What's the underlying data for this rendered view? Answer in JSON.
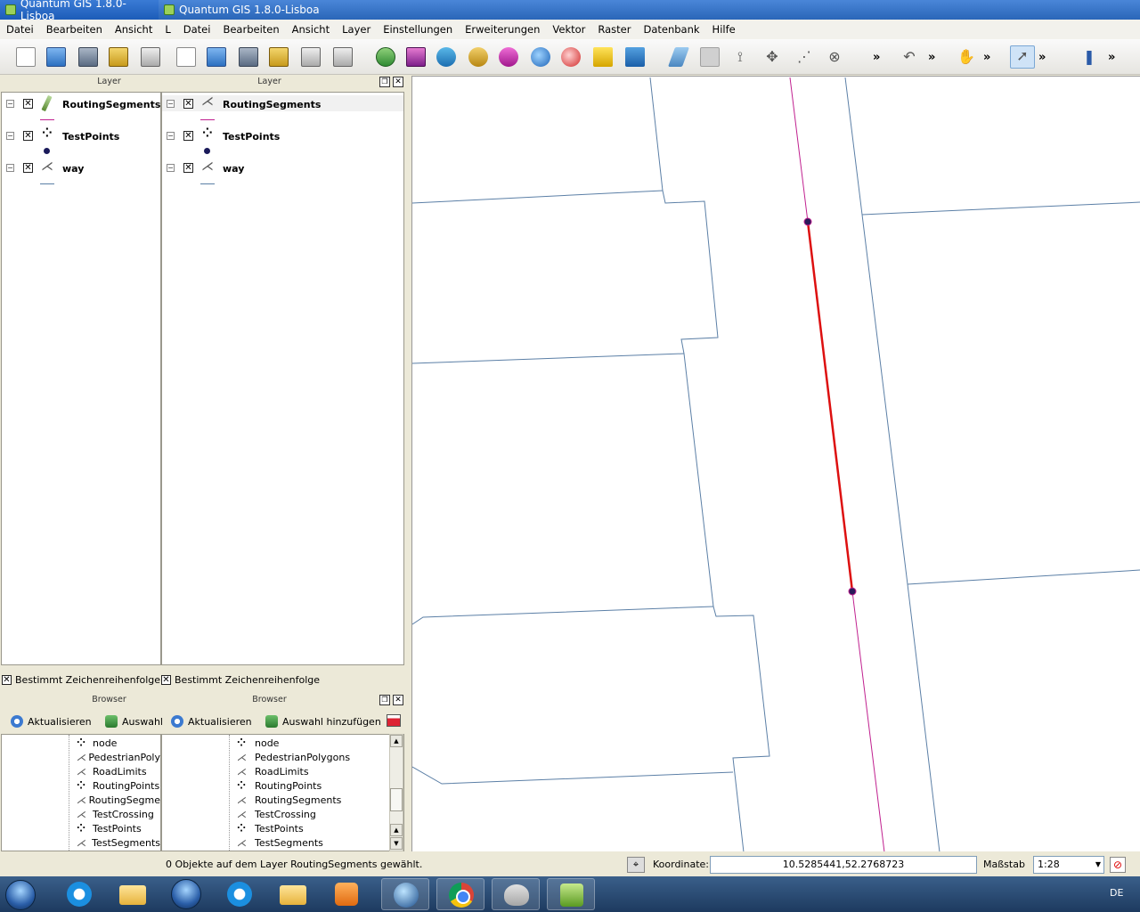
{
  "window": {
    "title1": "Quantum GIS 1.8.0-Lisboa",
    "title2": "Quantum GIS 1.8.0-Lisboa"
  },
  "menu1": [
    "Datei",
    "Bearbeiten",
    "Ansicht",
    "L"
  ],
  "menu2": [
    "Datei",
    "Bearbeiten",
    "Ansicht",
    "Layer",
    "Einstellungen",
    "Erweiterungen",
    "Vektor",
    "Raster",
    "Datenbank",
    "Hilfe"
  ],
  "toolbar": {
    "overflow": "»",
    "icons": [
      "new-project-icon",
      "open-project-icon",
      "save-project-icon",
      "save-as-icon",
      "print-composer-icon",
      "new-project-icon",
      "open-project-icon",
      "save-project-icon",
      "save-as-icon",
      "print-composer-icon",
      "print-icon",
      "add-vector-layer-icon",
      "add-raster-layer-icon",
      "add-postgis-layer-icon",
      "add-spatialite-layer-icon",
      "add-mssql-layer-icon",
      "add-wms-layer-icon",
      "add-wfs-layer-icon",
      "new-shapefile-icon",
      "remove-layer-icon",
      "toggle-editing-icon",
      "save-edits-icon",
      "add-feature-icon",
      "move-feature-icon",
      "node-tool-icon",
      "delete-selected-icon",
      "undo-icon",
      "pan-icon",
      "identify-icon",
      "help-icon"
    ]
  },
  "layers_left": {
    "header": "Layer",
    "items": [
      {
        "name": "RoutingSegments",
        "checked": "✕"
      },
      {
        "name": "TestPoints",
        "checked": "✕"
      },
      {
        "name": "way",
        "checked": "✕"
      }
    ],
    "render_order": "Bestimmt Zeichenreihenfolge"
  },
  "layers_right": {
    "header": "Layer",
    "items": [
      {
        "name": "RoutingSegments",
        "checked": "✕"
      },
      {
        "name": "TestPoints",
        "checked": "✕"
      },
      {
        "name": "way",
        "checked": "✕"
      }
    ],
    "render_order": "Bestimmt Zeichenreihenfolge"
  },
  "browser_left": {
    "header": "Browser",
    "refresh": "Aktualisieren",
    "add_selection": "Auswahl",
    "items": [
      "node",
      "PedestrianPoly",
      "RoadLimits",
      "RoutingPoints",
      "RoutingSegme",
      "TestCrossing",
      "TestPoints",
      "TestSegments"
    ]
  },
  "browser_right": {
    "header": "Browser",
    "refresh": "Aktualisieren",
    "add_selection": "Auswahl hinzufügen",
    "items": [
      "node",
      "PedestrianPolygons",
      "RoadLimits",
      "RoutingPoints",
      "RoutingSegments",
      "TestCrossing",
      "TestPoints",
      "TestSegments"
    ]
  },
  "status": {
    "message": "0 Objekte auf dem Layer RoutingSegments gewählt.",
    "coord_label": "Koordinate:",
    "coord_value": "10.5285441,52.2768723",
    "scale_label": "Maßstab",
    "scale_value": "1:28"
  },
  "taskbar": {
    "lang": "DE"
  },
  "colors": {
    "route_segment": "#dd1010",
    "route_line": "#c0208f",
    "way_lines": "#5b7fa6",
    "point_fill": "#2a1a5a"
  }
}
